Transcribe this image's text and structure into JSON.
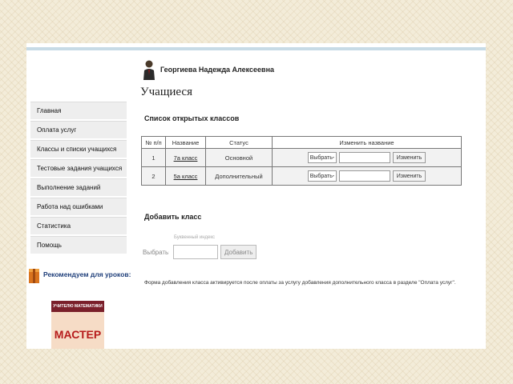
{
  "user": {
    "name": "Георгиева Надежда Алексеевна"
  },
  "page": {
    "title": "Учащиеся"
  },
  "sidebar": {
    "items": [
      {
        "label": "Главная"
      },
      {
        "label": "Оплата услуг"
      },
      {
        "label": "Классы и списки учащихся"
      },
      {
        "label": "Тестовые задания учащихся"
      },
      {
        "label": "Выполнение заданий"
      },
      {
        "label": "Работа над ошибками"
      },
      {
        "label": "Статистика"
      },
      {
        "label": "Помощь"
      }
    ]
  },
  "open_classes": {
    "title": "Список открытых классов",
    "headers": {
      "num": "№ п/п",
      "name": "Название",
      "status": "Статус",
      "rename": "Изменить название"
    },
    "rows": [
      {
        "num": "1",
        "name": "7а класс",
        "status": "Основной",
        "select": "Выбрать",
        "button": "Изменить"
      },
      {
        "num": "2",
        "name": "5а класс",
        "status": "Дополнительный",
        "select": "Выбрать",
        "button": "Изменить"
      }
    ]
  },
  "add_class": {
    "title": "Добавить класс",
    "hint": "Буквенный индекс",
    "select": "Выбрать",
    "button": "Добавить",
    "note": "Форма добавления класса активируется после оплаты за услугу добавления дополнительного класса в разделе \"Оплата услуг\"."
  },
  "recommend": {
    "label": "Рекомендуем для уроков:",
    "banner_small": "УЧИТЕЛЮ МАТЕМАТИКИ",
    "banner_big": "МАСТЕР"
  },
  "colors": {
    "topbar": "#c7dbe6",
    "accent": "#1f3f7a",
    "banner": "#7a1f2a"
  }
}
